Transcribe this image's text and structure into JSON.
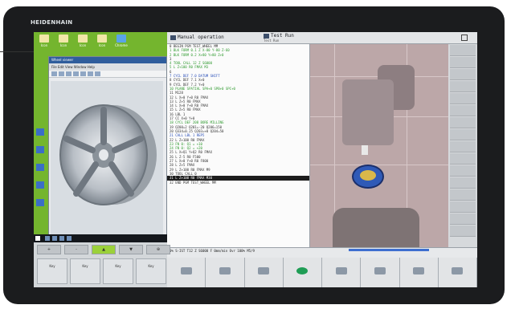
{
  "brand": "HEIDENHAIN",
  "header": {
    "mode1": "Manual operation",
    "mode2": "Test Run",
    "mode2_sub": "Test Run"
  },
  "desktop": {
    "icons": [
      "Icon",
      "Icon",
      "Icon",
      "Icon",
      "Chrome"
    ],
    "viewer_title": "Wheel viewer",
    "viewer_menu": "File  Edit  View  Window  Help"
  },
  "program": {
    "lines": [
      {
        "t": "0  BEGIN PGM TEST_WHEEL MM",
        "c": "gray"
      },
      {
        "t": "1    BLK FORM 0.1 Z X-80 Y-80 Z-60",
        "c": "green"
      },
      {
        "t": "2    BLK FORM 0.2 X+80 Y+80 Z+0",
        "c": "green"
      },
      {
        "t": "3",
        "c": "gray"
      },
      {
        "t": "4    TOOL CALL 12 Z S6000",
        "c": "green"
      },
      {
        "t": "5    L Z+100 R0 FMAX M3",
        "c": "green"
      },
      {
        "t": "6",
        "c": "gray"
      },
      {
        "t": "7    CYCL DEF 7.0 DATUM SHIFT",
        "c": "blue"
      },
      {
        "t": "8    CYCL DEF 7.1 X+0",
        "c": "gray"
      },
      {
        "t": "9    CYCL DEF 7.2 Y+0",
        "c": "gray"
      },
      {
        "t": "10   PLANE SPATIAL SPA+0 SPB+0 SPC+0",
        "c": "green"
      },
      {
        "t": "11   M128",
        "c": "gray"
      },
      {
        "t": "12   L X+0 Y+0 R0 FMAX",
        "c": "gray"
      },
      {
        "t": "13   L Z+5 R0 FMAX",
        "c": "gray"
      },
      {
        "t": "14   L X+0 Y+0 R0 FMAX",
        "c": "gray"
      },
      {
        "t": "15   L Z+5 R0 FMAX",
        "c": "gray"
      },
      {
        "t": "16   LBL 1",
        "c": "gray"
      },
      {
        "t": "17   CC X+0 Y+0",
        "c": "gray"
      },
      {
        "t": "18   CYCL DEF 208 BORE MILLING",
        "c": "green"
      },
      {
        "t": "19   Q200=2 Q201=-20 Q206=150",
        "c": "gray"
      },
      {
        "t": "20   Q334=0.25 Q203=+0 Q204=50",
        "c": "gray"
      },
      {
        "t": "21   CALL LBL 1 REP5",
        "c": "blue"
      },
      {
        "t": "22   L Z+100 R0 FMAX",
        "c": "gray"
      },
      {
        "t": "23   FN 0: Q1 = +10",
        "c": "green"
      },
      {
        "t": "24   FN 0: Q2 = +20",
        "c": "green"
      },
      {
        "t": "25   L X+Q1 Y+Q2 R0 FMAX",
        "c": "gray"
      },
      {
        "t": "26   L Z-5 R0 F500",
        "c": "gray"
      },
      {
        "t": "27   L X+0 Y+0 R0 F800",
        "c": "gray"
      },
      {
        "t": "28   L Z+5 FMAX",
        "c": "gray"
      },
      {
        "t": "29   L Z+100 R0 FMAX M9",
        "c": "gray"
      },
      {
        "t": "30   TOOL CALL 0",
        "c": "gray"
      },
      {
        "t": "31   L Z+100 R0 FMAX M30",
        "c": "sel"
      },
      {
        "t": "32   END PGM TEST_WHEEL MM",
        "c": "gray"
      }
    ]
  },
  "status": {
    "line": "0% S-IST  T12 Z S6000  F 0mm/min  Ovr 100%  M5/9"
  },
  "left_keys_row1": [
    "+",
    "-",
    "▲",
    "▼",
    "⊕"
  ],
  "left_keys_row2": [
    "Key",
    "Key",
    "Key",
    "Key"
  ],
  "softkeys": [
    {
      "label": "",
      "icon": "soft"
    },
    {
      "label": "",
      "icon": "soft"
    },
    {
      "label": "",
      "icon": "soft"
    },
    {
      "label": "",
      "icon": "green"
    },
    {
      "label": "",
      "icon": "soft"
    },
    {
      "label": "",
      "icon": "soft"
    },
    {
      "label": "",
      "icon": "soft"
    },
    {
      "label": "",
      "icon": "soft"
    }
  ],
  "colors": {
    "desktop": "#74b52e",
    "accent": "#3d6fd0",
    "sim_bg": "#bca7a8",
    "active_key": "#9bd13a"
  }
}
